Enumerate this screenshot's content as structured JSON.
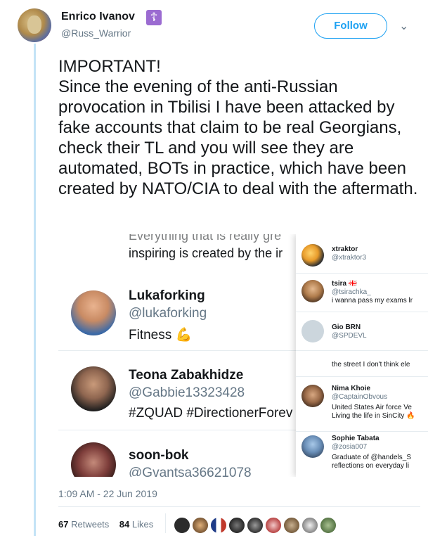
{
  "tweet": {
    "author_name": "Enrico Ivanov",
    "author_handle": "@Russ_Warrior",
    "badge_glyph": "☦",
    "follow_label": "Follow",
    "text_lines": [
      "IMPORTANT!",
      "Since the evening of the anti-Russian provocation in Tbilisi I have been attacked by fake accounts that claim to be real Georgians, check their TL and you will see they are automated, BOTs in practice, which have been created by NATO/CIA to deal with the aftermath."
    ],
    "timestamp": "1:09 AM - 22 Jun 2019",
    "retweets_count": "67",
    "retweets_label": "Retweets",
    "likes_count": "84",
    "likes_label": "Likes"
  },
  "embed": {
    "top_partial": "Everything that is really gre",
    "inspiring_line": "inspiring is created by the ir",
    "accounts": [
      {
        "name": "Lukaforking",
        "handle": "@lukaforking",
        "bio": "Fitness 💪"
      },
      {
        "name": "Teona Zabakhidze",
        "handle": "@Gabbie13323428",
        "bio": "#ZQUAD #DirectionerForev"
      },
      {
        "name": "soon-bok",
        "handle": "@Gvantsa36621078",
        "bio": ""
      }
    ],
    "side_accounts": [
      {
        "name": "xtraktor",
        "handle": "@xtraktor3",
        "bio": ""
      },
      {
        "name": "tsira 🇬🇪",
        "handle": "@tsirachka_",
        "bio": "i wanna pass my exams lr"
      },
      {
        "name": "Gio BRN",
        "handle": "@SPDEVL",
        "bio": ""
      },
      {
        "name": "",
        "handle": "",
        "bio": "the street I don't think ele"
      },
      {
        "name": "Nima Khoie",
        "handle": "@CaptainObvous",
        "bio": "United States Air force Ve",
        "bio2": "Living the life in SinCity 🔥"
      },
      {
        "name": "Sophie Tabata",
        "handle": "@zosia007",
        "bio": "Graduate of @handels_S",
        "bio2": "reflections on everyday li"
      }
    ]
  },
  "colors": {
    "accent": "#1da1f2",
    "muted": "#657786",
    "thread_line": "#c4e3f6"
  }
}
